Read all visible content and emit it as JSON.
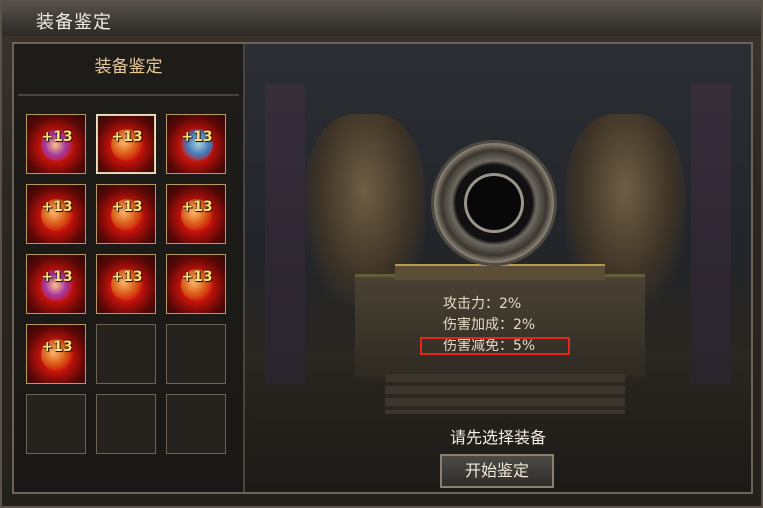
{
  "window": {
    "title": "装备鉴定"
  },
  "left_panel": {
    "title": "装备鉴定",
    "slots": [
      {
        "filled": true,
        "level": "+13",
        "selected": false,
        "tint": "purple"
      },
      {
        "filled": true,
        "level": "+13",
        "selected": true,
        "tint": "red"
      },
      {
        "filled": true,
        "level": "+13",
        "selected": false,
        "tint": "blue"
      },
      {
        "filled": true,
        "level": "+13",
        "selected": false,
        "tint": "red"
      },
      {
        "filled": true,
        "level": "+13",
        "selected": false,
        "tint": "red"
      },
      {
        "filled": true,
        "level": "+13",
        "selected": false,
        "tint": "red"
      },
      {
        "filled": true,
        "level": "+13",
        "selected": false,
        "tint": "purple"
      },
      {
        "filled": true,
        "level": "+13",
        "selected": false,
        "tint": "red"
      },
      {
        "filled": true,
        "level": "+13",
        "selected": false,
        "tint": "red"
      },
      {
        "filled": true,
        "level": "+13",
        "selected": false,
        "tint": "red"
      },
      {
        "filled": false
      },
      {
        "filled": false
      },
      {
        "filled": false
      },
      {
        "filled": false
      },
      {
        "filled": false
      }
    ]
  },
  "altar": {
    "stats": [
      "攻击力：2%",
      "伤害加成：2%",
      "伤害减免：5%"
    ],
    "highlighted_stat_index": 2,
    "hint": "请先选择装备",
    "start_button": "开始鉴定"
  },
  "colors": {
    "highlight": "#e3261c",
    "level_text": "#ffe07a",
    "title_text": "#e7c89a"
  }
}
